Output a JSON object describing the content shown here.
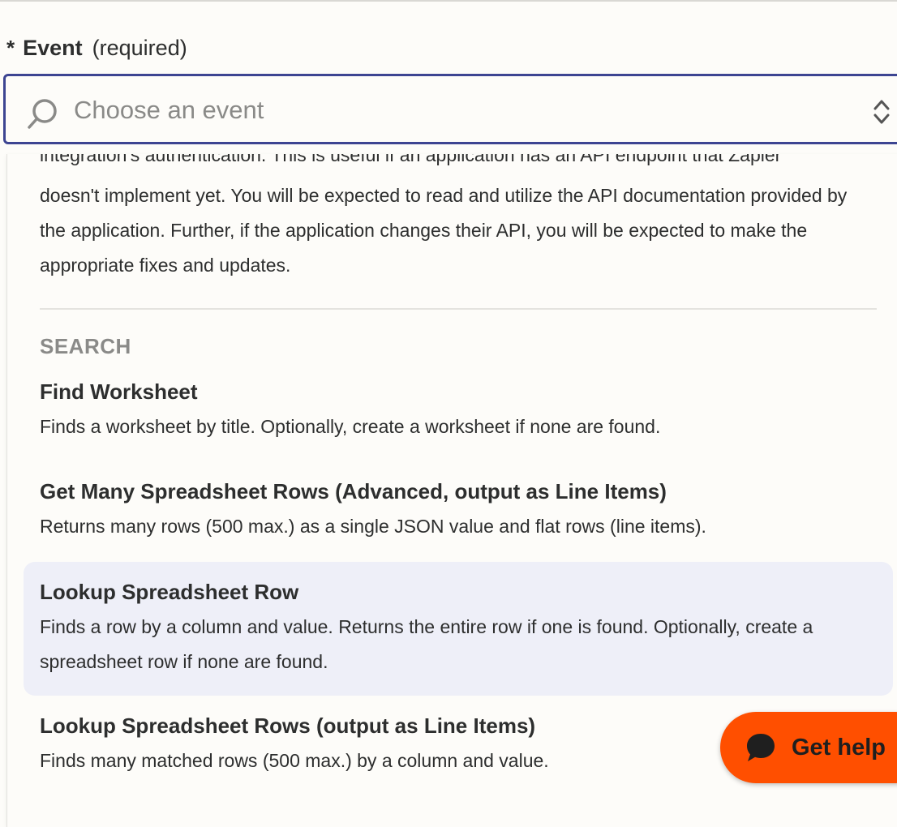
{
  "field": {
    "asterisk": "*",
    "label": "Event",
    "required_note": "(required)"
  },
  "select": {
    "placeholder": "Choose an event",
    "search_icon": "search-icon",
    "chevron_icon": "chevron-up-down-icon"
  },
  "dropdown": {
    "cutoff_text": "integration's authentication. This is useful if an application has an API endpoint that Zapier",
    "intro_text": "doesn't implement yet. You will be expected to read and utilize the API documentation provided by the application. Further, if the application changes their API, you will be expected to make the appropriate fixes and updates.",
    "section_heading": "SEARCH",
    "options": [
      {
        "title": "Find Worksheet",
        "description": "Finds a worksheet by title. Optionally, create a worksheet if none are found."
      },
      {
        "title": "Get Many Spreadsheet Rows (Advanced, output as Line Items)",
        "description": "Returns many rows (500 max.) as a single JSON value and flat rows (line items)."
      },
      {
        "title": "Lookup Spreadsheet Row",
        "description": "Finds a row by a column and value. Returns the entire row if one is found. Optionally, create a spreadsheet row if none are found."
      },
      {
        "title": "Lookup Spreadsheet Rows (output as Line Items)",
        "description": "Finds many matched rows (500 max.) by a column and value."
      }
    ]
  },
  "help": {
    "label": "Get help",
    "icon": "chat-bubble-icon"
  },
  "colors": {
    "focus_border": "#3d4592",
    "highlight_bg": "#eeeff8",
    "help_button": "#ff4f00"
  }
}
